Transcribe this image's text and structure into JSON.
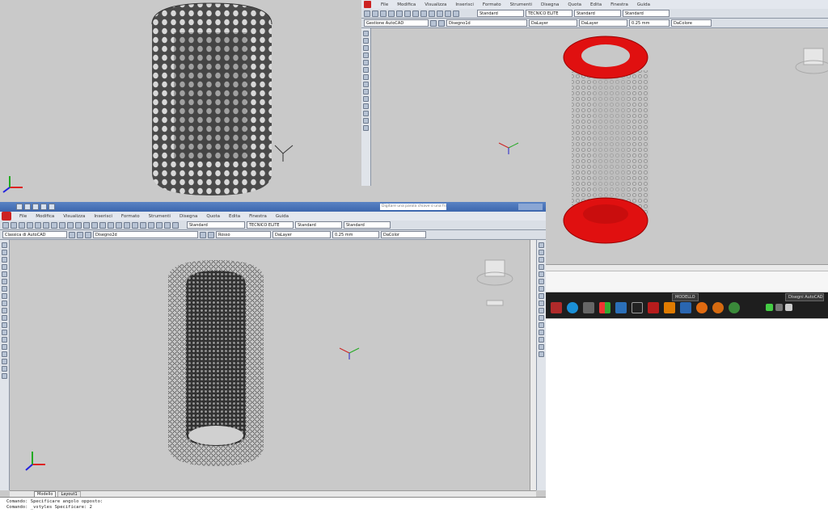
{
  "win_top_right": {
    "menu": [
      "File",
      "Modifica",
      "Visualizza",
      "Inserisci",
      "Formato",
      "Strumenti",
      "Disegna",
      "Quota",
      "Edita",
      "Finestra",
      "Guida"
    ],
    "styles": [
      "Standard",
      "TECNICO ELITE",
      "Standard",
      "Standard"
    ],
    "workspace": "Gestione AutoCAD",
    "layer": "Disegno1d",
    "props": [
      "DaLayer",
      "DaLayer",
      "0.25 mm",
      "DaColore"
    ]
  },
  "win_main": {
    "menu": [
      "File",
      "Modifica",
      "Visualizza",
      "Inserisci",
      "Formato",
      "Strumenti",
      "Disegna",
      "Quota",
      "Edita",
      "Finestra",
      "Guida"
    ],
    "styles": [
      "Standard",
      "TECNICO ELITE",
      "Standard",
      "Standard"
    ],
    "workspace": "Classica di AutoCAD",
    "layer": "Disegno2d",
    "props": [
      "Rosso",
      "DaLayer",
      "0.25 mm",
      "DaColor"
    ],
    "titlebar_hint": "Digitare una parola chiave o una frase",
    "tabs": [
      "Modello",
      "Layout1"
    ],
    "command_lines": [
      "Comando: Specificare angolo opposto:",
      "Comando: _vstyles Specificare: 2"
    ]
  },
  "taskbar": {
    "task_label": "Disegni AutoCAD",
    "clock_label": "MODELLO"
  },
  "colors": {
    "viewport": "#c9c9c9",
    "accent_red": "#e01010",
    "toolbar": "#dadfe6"
  }
}
